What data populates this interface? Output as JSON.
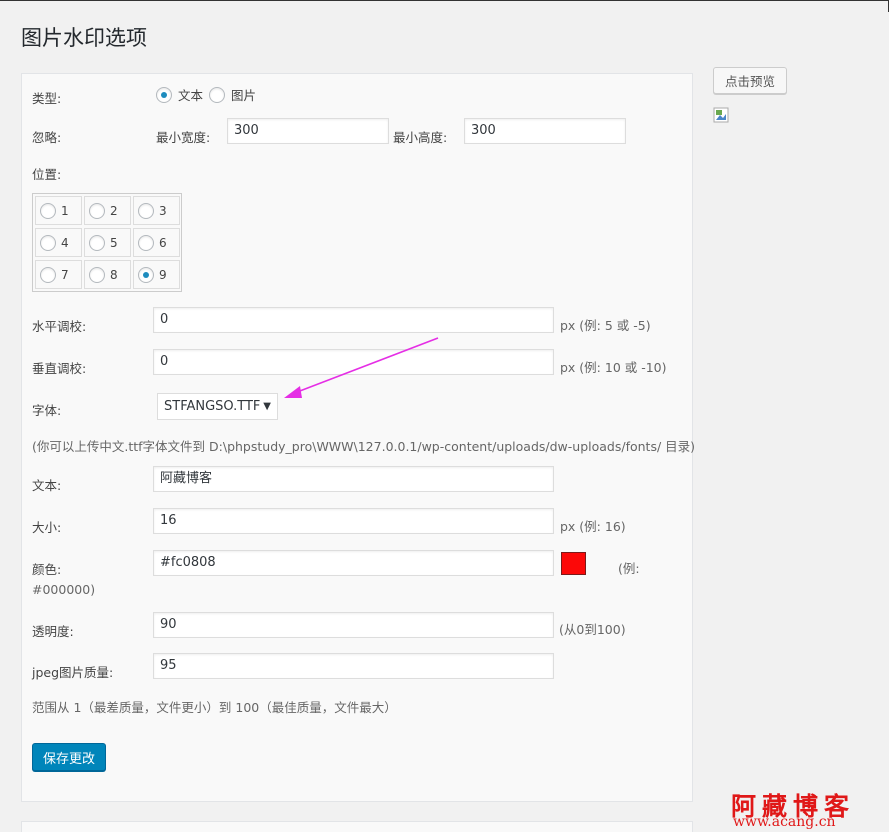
{
  "page_title": "图片水印选项",
  "type_row": {
    "label": "类型:",
    "options": [
      "文本",
      "图片"
    ],
    "selected": "文本"
  },
  "ignore_row": {
    "label": "忽略:",
    "min_width_label": "最小宽度:",
    "min_width": "300",
    "min_height_label": "最小高度:",
    "min_height": "300"
  },
  "position": {
    "label": "位置:",
    "cells": [
      "1",
      "2",
      "3",
      "4",
      "5",
      "6",
      "7",
      "8",
      "9"
    ],
    "selected": "9"
  },
  "h_adjust": {
    "label": "水平调校:",
    "value": "0",
    "hint": "px (例:  5 或 -5)"
  },
  "v_adjust": {
    "label": "垂直调校:",
    "value": "0",
    "hint": "px (例:  10 或 -10)"
  },
  "font": {
    "label": "字体:",
    "selected": "STFANGSO.TTF",
    "note": "(你可以上传中文.ttf字体文件到 D:\\phpstudy_pro\\WWW\\127.0.0.1/wp-content/uploads/dw-uploads/fonts/ 目录)"
  },
  "text": {
    "label": "文本:",
    "value": "阿藏博客"
  },
  "size": {
    "label": "大小:",
    "value": "16",
    "hint": "px (例:  16)"
  },
  "color": {
    "label": "颜色:",
    "value": "#fc0808",
    "hint_a": "(例:",
    "hint_b": "#000000)",
    "swatch": "#fc0808"
  },
  "opacity": {
    "label": "透明度:",
    "value": "90",
    "hint": "(从0到100)"
  },
  "jpeg": {
    "label": "jpeg图片质量:",
    "value": "95",
    "note": "范围从 1（最差质量，文件更小）到 100（最佳质量，文件最大）"
  },
  "save_button": "保存更改",
  "preview_button": "点击预览",
  "watermark": {
    "text": "阿藏博客",
    "url": "www.acang.cn",
    "color": "#e01818"
  },
  "colors": {
    "accent": "#0085ba",
    "annotation_arrow": "#e52ee5"
  }
}
